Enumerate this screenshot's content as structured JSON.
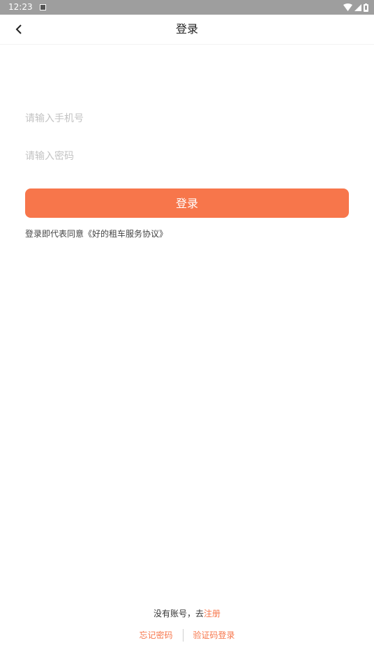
{
  "status_bar": {
    "time": "12:23",
    "icons": [
      "notification-icon",
      "wifi-icon",
      "signal-icon",
      "battery-icon"
    ]
  },
  "header": {
    "title": "登录",
    "back_icon": "chevron-left-icon"
  },
  "form": {
    "phone_placeholder": "请输入手机号",
    "phone_value": "",
    "password_placeholder": "请输入密码",
    "password_value": "",
    "login_label": "登录",
    "agreement_prefix": "登录即代表同意",
    "agreement_link": "《好的租车服务协议》"
  },
  "footer": {
    "register_prompt": "没有账号，去",
    "register_link": "注册",
    "forgot_password": "忘记密码",
    "sms_login": "验证码登录"
  },
  "colors": {
    "accent": "#f7764b",
    "status_bar": "#9e9e9e",
    "placeholder": "#c3c3c3"
  }
}
